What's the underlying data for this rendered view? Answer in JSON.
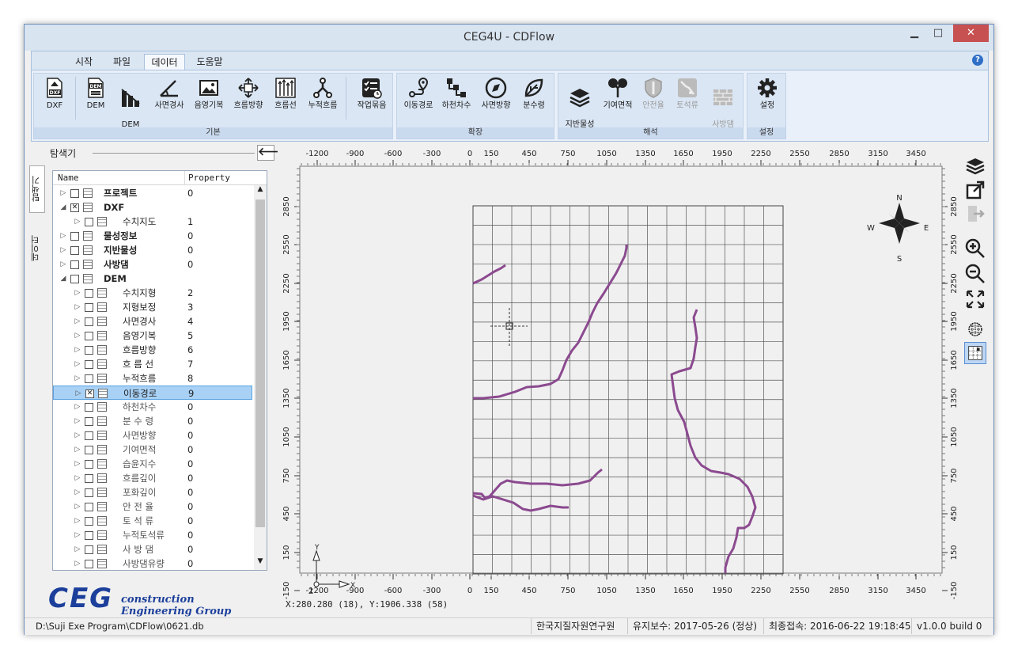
{
  "window": {
    "title": "CEG4U - CDFlow"
  },
  "menu": {
    "tabs": [
      "시작",
      "파일",
      "데이터",
      "도움말"
    ],
    "active": "데이터"
  },
  "ribbon": {
    "groups": [
      {
        "label": "기본",
        "buttons": [
          "DXF",
          "DEM",
          "DEM\n보정",
          "사면경사",
          "음영기복",
          "흐름방향",
          "흐름선",
          "누적흐름",
          "작업묶음"
        ]
      },
      {
        "label": "확장",
        "buttons": [
          "이동경로",
          "하천차수",
          "사면방향",
          "분수령"
        ]
      },
      {
        "label": "해석",
        "buttons": [
          "지반물성\n보간",
          "기여면적",
          "안전율",
          "토석류",
          "사방댐\n설계"
        ]
      },
      {
        "label": "설정",
        "buttons": [
          "설정"
        ]
      }
    ]
  },
  "explorer": {
    "title": "탐색기",
    "side_tabs": [
      "탐색기",
      "데이터"
    ],
    "columns": [
      "Name",
      "Property"
    ],
    "rows": [
      {
        "name": "프로젝트",
        "value": "0",
        "bold": true,
        "level": 0,
        "exp": "▷",
        "cb": ""
      },
      {
        "name": "DXF",
        "value": "",
        "bold": true,
        "level": 0,
        "exp": "◢",
        "cb": "x"
      },
      {
        "name": "수치지도",
        "value": "1",
        "bold": false,
        "level": 1,
        "exp": "▷",
        "cb": ""
      },
      {
        "name": "물성정보",
        "value": "0",
        "bold": true,
        "level": 0,
        "exp": "▷",
        "cb": ""
      },
      {
        "name": "지반물성",
        "value": "0",
        "bold": true,
        "level": 0,
        "exp": "▷",
        "cb": ""
      },
      {
        "name": "사방댐",
        "value": "0",
        "bold": true,
        "level": 0,
        "exp": "▷",
        "cb": ""
      },
      {
        "name": "DEM",
        "value": "",
        "bold": true,
        "level": 0,
        "exp": "◢",
        "cb": ""
      },
      {
        "name": "수치지형",
        "value": "2",
        "bold": false,
        "level": 1,
        "exp": "▷",
        "cb": ""
      },
      {
        "name": "지형보정",
        "value": "3",
        "bold": false,
        "level": 1,
        "exp": "▷",
        "cb": ""
      },
      {
        "name": "사면경사",
        "value": "4",
        "bold": false,
        "level": 1,
        "exp": "▷",
        "cb": ""
      },
      {
        "name": "음영기복",
        "value": "5",
        "bold": false,
        "level": 1,
        "exp": "▷",
        "cb": ""
      },
      {
        "name": "흐름방향",
        "value": "6",
        "bold": false,
        "level": 1,
        "exp": "▷",
        "cb": ""
      },
      {
        "name": "흐 름 선",
        "value": "7",
        "bold": false,
        "level": 1,
        "exp": "▷",
        "cb": ""
      },
      {
        "name": "누적흐름",
        "value": "8",
        "bold": false,
        "level": 1,
        "exp": "▷",
        "cb": ""
      },
      {
        "name": "이동경로",
        "value": "9",
        "bold": false,
        "level": 1,
        "exp": "▷",
        "cb": "x",
        "selected": true
      },
      {
        "name": "하천차수",
        "value": "0",
        "bold": false,
        "level": 1,
        "exp": "▷",
        "cb": "",
        "dim": true
      },
      {
        "name": "분 수 령",
        "value": "0",
        "bold": false,
        "level": 1,
        "exp": "▷",
        "cb": "",
        "dim": true
      },
      {
        "name": "사면방향",
        "value": "0",
        "bold": false,
        "level": 1,
        "exp": "▷",
        "cb": "",
        "dim": true
      },
      {
        "name": "기여면적",
        "value": "0",
        "bold": false,
        "level": 1,
        "exp": "▷",
        "cb": "",
        "dim": true
      },
      {
        "name": "습윤지수",
        "value": "0",
        "bold": false,
        "level": 1,
        "exp": "▷",
        "cb": "",
        "dim": true
      },
      {
        "name": "흐름깊이",
        "value": "0",
        "bold": false,
        "level": 1,
        "exp": "▷",
        "cb": "",
        "dim": true
      },
      {
        "name": "포화깊이",
        "value": "0",
        "bold": false,
        "level": 1,
        "exp": "▷",
        "cb": "",
        "dim": true
      },
      {
        "name": "안 전 율",
        "value": "0",
        "bold": false,
        "level": 1,
        "exp": "▷",
        "cb": "",
        "dim": true
      },
      {
        "name": "토 석 류",
        "value": "0",
        "bold": false,
        "level": 1,
        "exp": "▷",
        "cb": "",
        "dim": true
      },
      {
        "name": "누적토석류",
        "value": "0",
        "bold": false,
        "level": 1,
        "exp": "▷",
        "cb": "",
        "dim": true
      },
      {
        "name": "사 방 댐",
        "value": "0",
        "bold": false,
        "level": 1,
        "exp": "▷",
        "cb": "",
        "dim": true
      },
      {
        "name": "사방댐유량",
        "value": "0",
        "bold": false,
        "level": 1,
        "exp": "▷",
        "cb": "",
        "dim": true
      }
    ]
  },
  "logo": {
    "letters": "CEG",
    "text": "construction Engineering Group"
  },
  "map": {
    "x_ticks": [
      "-1200",
      "-900",
      "-600",
      "-300",
      "0",
      "150",
      "450",
      "750",
      "1050",
      "1350",
      "1650",
      "1950",
      "2250",
      "2550",
      "2850",
      "3150",
      "3450"
    ],
    "y_ticks": [
      "2850",
      "2550",
      "2250",
      "1950",
      "1650",
      "1350",
      "1050",
      "750",
      "450",
      "150",
      "-150"
    ],
    "compass": [
      "N",
      "E",
      "S",
      "W"
    ],
    "axis_labels": [
      "X",
      "Y",
      "Z"
    ],
    "cursor_readout": "X:280.280 (18), Y:1906.338 (58)",
    "path_color": "#8b4a8f"
  },
  "status": {
    "path": "D:\\Suji Exe Program\\CDFlow\\0621.db",
    "org": "한국지질자원연구원",
    "maintenance": "유지보수: 2017-05-26 (정상)",
    "last_access": "최종접속: 2016-06-22 19:18:45",
    "version": "v1.0.0 build 0"
  }
}
